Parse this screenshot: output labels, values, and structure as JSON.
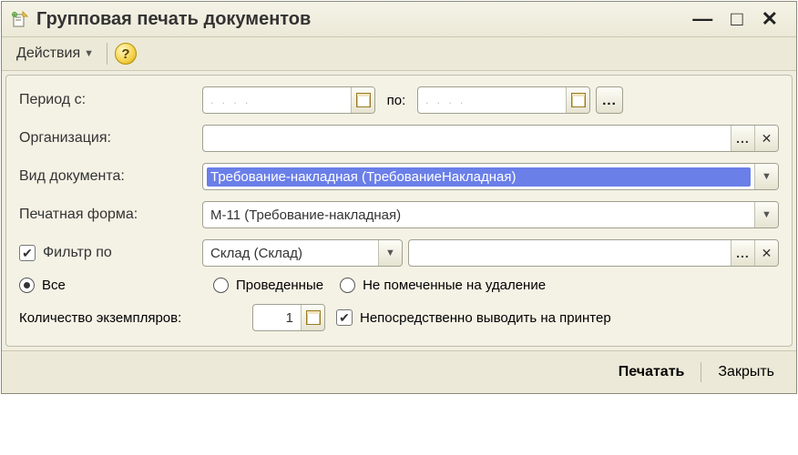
{
  "window": {
    "title": "Групповая печать документов"
  },
  "toolbar": {
    "actions_label": "Действия"
  },
  "form": {
    "period_from_label": "Период с:",
    "period_to_label": "по:",
    "period_from_value": ". .   . .",
    "period_to_value": ". .   . .",
    "organization_label": "Организация:",
    "organization_value": "",
    "doc_type_label": "Вид документа:",
    "doc_type_value": "Требование-накладная (ТребованиеНакладная)",
    "print_form_label": "Печатная форма:",
    "print_form_value": "М-11 (Требование-накладная)",
    "filter_label": "Фильтр по",
    "filter_field": "Склад (Склад)",
    "filter_value": "",
    "radio_all": "Все",
    "radio_posted": "Проведенные",
    "radio_not_marked": "Не помеченные на удаление",
    "copies_label": "Количество экземпляров:",
    "copies_value": "1",
    "direct_print_label": "Непосредственно выводить на принтер"
  },
  "footer": {
    "print": "Печатать",
    "close": "Закрыть"
  }
}
